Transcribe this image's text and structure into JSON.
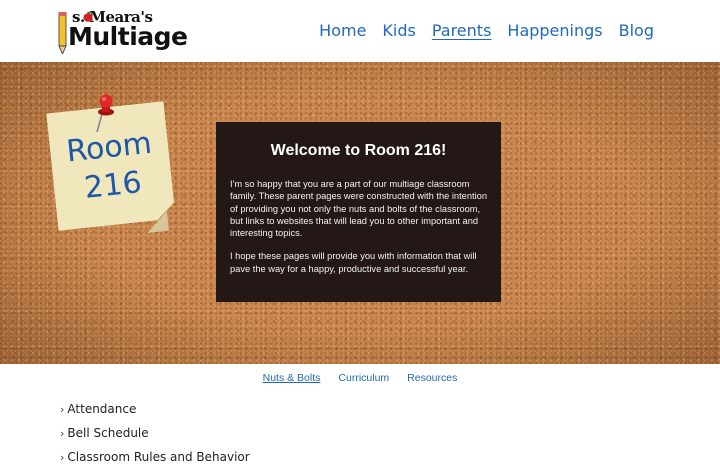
{
  "logo": {
    "line1": "s.  Meara's",
    "line2": "Multiage",
    "initial": "M"
  },
  "nav": [
    {
      "label": "Home",
      "active": false
    },
    {
      "label": "Kids",
      "active": false
    },
    {
      "label": "Parents",
      "active": true
    },
    {
      "label": "Happenings",
      "active": false
    },
    {
      "label": "Blog",
      "active": false
    }
  ],
  "note": {
    "line1": "Room",
    "line2": "216"
  },
  "welcome": {
    "title": "Welcome to Room 216!",
    "paragraph1": "I'm so happy that you are a part of our multiage classroom family. These parent pages were constructed with the intention of providing you not only the nuts and bolts of the classroom, but links to websites that will lead you to other important and interesting topics.",
    "paragraph2": "I hope these pages will provide you with information that will pave the way for a happy, productive and successful year."
  },
  "tabs": [
    {
      "label": "Nuts & Bolts",
      "active": true
    },
    {
      "label": "Curriculum",
      "active": false
    },
    {
      "label": "Resources",
      "active": false
    }
  ],
  "list": [
    {
      "label": "Attendance"
    },
    {
      "label": "Bell Schedule"
    },
    {
      "label": "Classroom Rules and Behavior"
    }
  ],
  "colors": {
    "link": "#1f69b8",
    "welcome_bg": "#231815",
    "cork": "#c9874f",
    "note": "#f1e7bd",
    "note_text": "#1d57a8"
  }
}
